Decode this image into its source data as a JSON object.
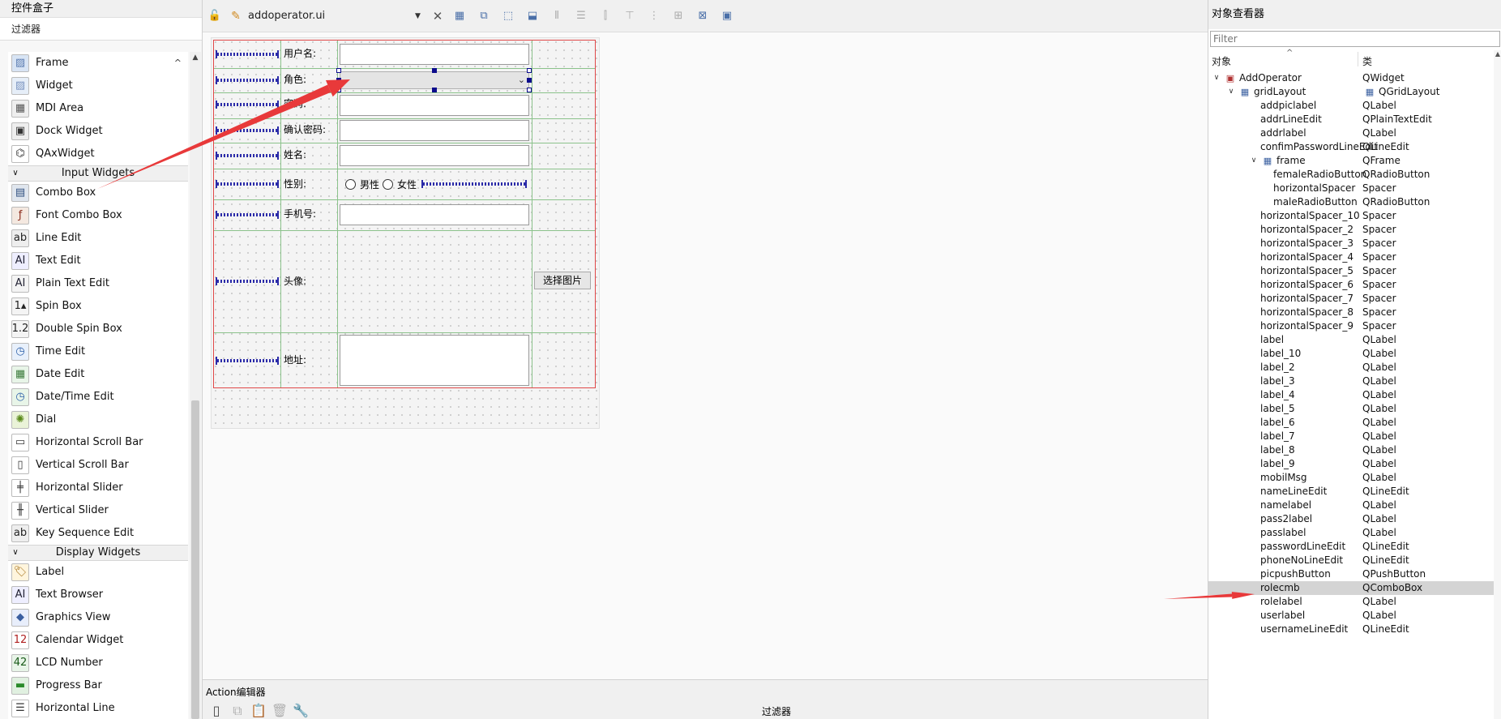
{
  "widget_box": {
    "title": "控件盒子",
    "filter_label": "过滤器",
    "items_top": [
      {
        "label": "Frame",
        "icon": "frame-icon"
      },
      {
        "label": "Widget",
        "icon": "widget-icon"
      },
      {
        "label": "MDI Area",
        "icon": "mdi-area-icon"
      },
      {
        "label": "Dock Widget",
        "icon": "dock-widget-icon"
      },
      {
        "label": "QAxWidget",
        "icon": "qaxwidget-icon"
      }
    ],
    "category_input": "Input Widgets",
    "items_input": [
      {
        "label": "Combo Box",
        "icon": "combo-box-icon"
      },
      {
        "label": "Font Combo Box",
        "icon": "font-combo-box-icon"
      },
      {
        "label": "Line Edit",
        "icon": "line-edit-icon"
      },
      {
        "label": "Text Edit",
        "icon": "text-edit-icon"
      },
      {
        "label": "Plain Text Edit",
        "icon": "plain-text-edit-icon"
      },
      {
        "label": "Spin Box",
        "icon": "spin-box-icon"
      },
      {
        "label": "Double Spin Box",
        "icon": "double-spin-box-icon"
      },
      {
        "label": "Time Edit",
        "icon": "time-edit-icon"
      },
      {
        "label": "Date Edit",
        "icon": "date-edit-icon"
      },
      {
        "label": "Date/Time Edit",
        "icon": "date-time-edit-icon"
      },
      {
        "label": "Dial",
        "icon": "dial-icon"
      },
      {
        "label": "Horizontal Scroll Bar",
        "icon": "horizontal-scroll-bar-icon"
      },
      {
        "label": "Vertical Scroll Bar",
        "icon": "vertical-scroll-bar-icon"
      },
      {
        "label": "Horizontal Slider",
        "icon": "horizontal-slider-icon"
      },
      {
        "label": "Vertical Slider",
        "icon": "vertical-slider-icon"
      },
      {
        "label": "Key Sequence Edit",
        "icon": "key-sequence-edit-icon"
      }
    ],
    "category_display": "Display Widgets",
    "items_display": [
      {
        "label": "Label",
        "icon": "label-icon"
      },
      {
        "label": "Text Browser",
        "icon": "text-browser-icon"
      },
      {
        "label": "Graphics View",
        "icon": "graphics-view-icon"
      },
      {
        "label": "Calendar Widget",
        "icon": "calendar-widget-icon"
      },
      {
        "label": "LCD Number",
        "icon": "lcd-number-icon"
      },
      {
        "label": "Progress Bar",
        "icon": "progress-bar-icon"
      },
      {
        "label": "Horizontal Line",
        "icon": "horizontal-line-icon"
      }
    ]
  },
  "editor": {
    "file_name": "addoperator.ui",
    "form": {
      "username_label": "用户名:",
      "role_label": "角色:",
      "password_label": "密码:",
      "confirm_password_label": "确认密码:",
      "name_label": "姓名:",
      "gender_label": "性别:",
      "male_label": "男性",
      "female_label": "女性",
      "phone_label": "手机号:",
      "avatar_label": "头像:",
      "choose_picture_button": "选择图片",
      "address_label": "地址:"
    }
  },
  "action_editor": {
    "title": "Action编辑器",
    "filter_label": "过滤器"
  },
  "inspector": {
    "title": "对象查看器",
    "filter_placeholder": "Filter",
    "col_object": "对象",
    "col_class": "类",
    "rows": [
      {
        "name": "AddOperator",
        "cls": "QWidget",
        "level": 0,
        "expanded": true,
        "icon": "form-icon"
      },
      {
        "name": "gridLayout",
        "cls": "QGridLayout",
        "level": 1,
        "expanded": true,
        "icon": "grid-layout-icon"
      },
      {
        "name": "addpiclabel",
        "cls": "QLabel",
        "level": 2
      },
      {
        "name": "addrLineEdit",
        "cls": "QPlainTextEdit",
        "level": 2
      },
      {
        "name": "addrlabel",
        "cls": "QLabel",
        "level": 2
      },
      {
        "name": "confimPasswordLineEdit",
        "cls": "QLineEdit",
        "level": 2
      },
      {
        "name": "frame",
        "cls": "QFrame",
        "level": 2,
        "expanded": true,
        "icon": "grid-layout-icon"
      },
      {
        "name": "femaleRadioButton",
        "cls": "QRadioButton",
        "level": 3
      },
      {
        "name": "horizontalSpacer",
        "cls": "Spacer",
        "level": 3
      },
      {
        "name": "maleRadioButton",
        "cls": "QRadioButton",
        "level": 3
      },
      {
        "name": "horizontalSpacer_10",
        "cls": "Spacer",
        "level": 2
      },
      {
        "name": "horizontalSpacer_2",
        "cls": "Spacer",
        "level": 2
      },
      {
        "name": "horizontalSpacer_3",
        "cls": "Spacer",
        "level": 2
      },
      {
        "name": "horizontalSpacer_4",
        "cls": "Spacer",
        "level": 2
      },
      {
        "name": "horizontalSpacer_5",
        "cls": "Spacer",
        "level": 2
      },
      {
        "name": "horizontalSpacer_6",
        "cls": "Spacer",
        "level": 2
      },
      {
        "name": "horizontalSpacer_7",
        "cls": "Spacer",
        "level": 2
      },
      {
        "name": "horizontalSpacer_8",
        "cls": "Spacer",
        "level": 2
      },
      {
        "name": "horizontalSpacer_9",
        "cls": "Spacer",
        "level": 2
      },
      {
        "name": "label",
        "cls": "QLabel",
        "level": 2
      },
      {
        "name": "label_10",
        "cls": "QLabel",
        "level": 2
      },
      {
        "name": "label_2",
        "cls": "QLabel",
        "level": 2
      },
      {
        "name": "label_3",
        "cls": "QLabel",
        "level": 2
      },
      {
        "name": "label_4",
        "cls": "QLabel",
        "level": 2
      },
      {
        "name": "label_5",
        "cls": "QLabel",
        "level": 2
      },
      {
        "name": "label_6",
        "cls": "QLabel",
        "level": 2
      },
      {
        "name": "label_7",
        "cls": "QLabel",
        "level": 2
      },
      {
        "name": "label_8",
        "cls": "QLabel",
        "level": 2
      },
      {
        "name": "label_9",
        "cls": "QLabel",
        "level": 2
      },
      {
        "name": "mobilMsg",
        "cls": "QLabel",
        "level": 2
      },
      {
        "name": "nameLineEdit",
        "cls": "QLineEdit",
        "level": 2
      },
      {
        "name": "namelabel",
        "cls": "QLabel",
        "level": 2
      },
      {
        "name": "pass2label",
        "cls": "QLabel",
        "level": 2
      },
      {
        "name": "passlabel",
        "cls": "QLabel",
        "level": 2
      },
      {
        "name": "passwordLineEdit",
        "cls": "QLineEdit",
        "level": 2
      },
      {
        "name": "phoneNoLineEdit",
        "cls": "QLineEdit",
        "level": 2
      },
      {
        "name": "picpushButton",
        "cls": "QPushButton",
        "level": 2
      },
      {
        "name": "rolecmb",
        "cls": "QComboBox",
        "level": 2,
        "selected": true
      },
      {
        "name": "rolelabel",
        "cls": "QLabel",
        "level": 2
      },
      {
        "name": "userlabel",
        "cls": "QLabel",
        "level": 2
      },
      {
        "name": "usernameLineEdit",
        "cls": "QLineEdit",
        "level": 2
      }
    ]
  },
  "colors": {
    "annotation_arrow": "#e8393a",
    "selection": "#d4d4d4",
    "layout_border": "#e04848",
    "grid_line": "#8bc28b",
    "spacer": "#2a2aa8"
  }
}
